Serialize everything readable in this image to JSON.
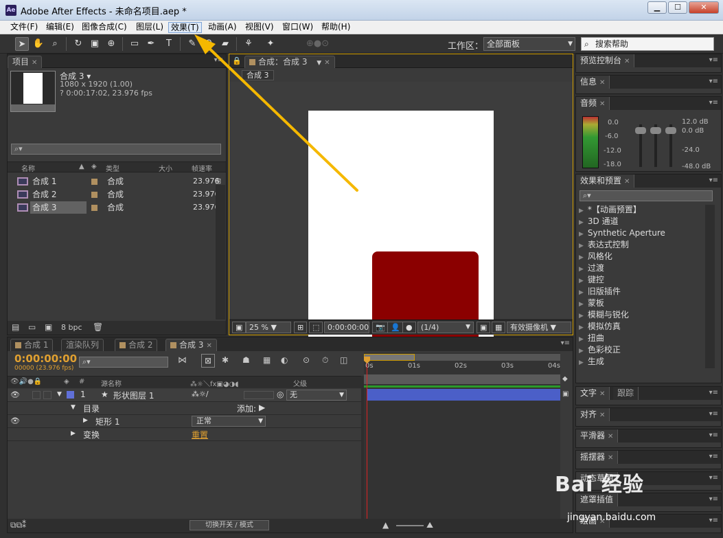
{
  "window": {
    "title": "Adobe After Effects - 未命名项目.aep *",
    "logo": "Ae",
    "buttons": [
      "▁",
      "☐",
      "✕"
    ]
  },
  "menu": [
    "文件(F)",
    "编辑(E)",
    "图像合成(C)",
    "图层(L)",
    "效果(T)",
    "动画(A)",
    "视图(V)",
    "窗口(W)",
    "帮助(H)"
  ],
  "toolbar": {
    "workspace_label": "工作区：",
    "workspace_value": "全部面板",
    "help_placeholder": "搜索帮助"
  },
  "project": {
    "tab": "项目",
    "selected_comp": "合成 3 ▾",
    "info_line1": "1080 x 1920 (1.00)",
    "info_line2": "? 0:00:17:02, 23.976 fps",
    "headers": {
      "name": "名称",
      "type": "类型",
      "size": "大小",
      "rate": "帧速率"
    },
    "items": [
      {
        "name": "合成 1",
        "type": "合成",
        "rate": "23.976"
      },
      {
        "name": "合成 2",
        "type": "合成",
        "rate": "23.976"
      },
      {
        "name": "合成 3",
        "type": "合成",
        "rate": "23.976"
      }
    ],
    "bpc": "8 bpc"
  },
  "composition": {
    "tab": "合成：合成 3",
    "sub_tab": "合成 3",
    "zoom": "25 %",
    "timecode": "0:00:00:00",
    "resolution": "(1/4)",
    "camera": "有效摄像机"
  },
  "right_panels": {
    "preview": "预览控制台",
    "info": "信息",
    "audio": "音频",
    "audio_levels": [
      "0.0",
      "-6.0",
      "-12.0",
      "-18.0"
    ],
    "audio_db": [
      "12.0 dB",
      "0.0 dB",
      "-24.0",
      "-48.0 dB"
    ],
    "effects": "效果和预置",
    "effects_items": [
      "*【动画预置】",
      "3D 通道",
      "Synthetic Aperture",
      "表达式控制",
      "风格化",
      "过渡",
      "键控",
      "旧版插件",
      "蒙板",
      "模糊与锐化",
      "模拟仿真",
      "扭曲",
      "色彩校正",
      "生成"
    ],
    "text": "文字",
    "paragraph": "跟踪",
    "align": "对齐",
    "smoother": "平滑器",
    "wiggler": "摇摆器",
    "motion_sketch": "动态草图",
    "mask_interp": "遮罩插值",
    "paint": "绘画"
  },
  "timeline": {
    "tabs": [
      "合成 1",
      "渲染队列",
      "合成 2",
      "合成 3"
    ],
    "timecode": "0:00:00:00",
    "frames": "00000 (23.976 fps)",
    "col_layer_name": "源名称",
    "col_parent": "父级",
    "ruler": [
      "0s",
      "01s",
      "02s",
      "03s",
      "04s"
    ],
    "layer_num": "1",
    "layer_name": "形状图层 1",
    "parent_value": "无",
    "contents": "目录",
    "add": "添加:",
    "rect": "矩形 1",
    "blend": "正常",
    "transform": "变换",
    "reset": "重置",
    "toggle_modes": "切换开关 / 模式"
  },
  "watermark": {
    "text": "Bai 经验",
    "url": "jingyan.baidu.com"
  }
}
